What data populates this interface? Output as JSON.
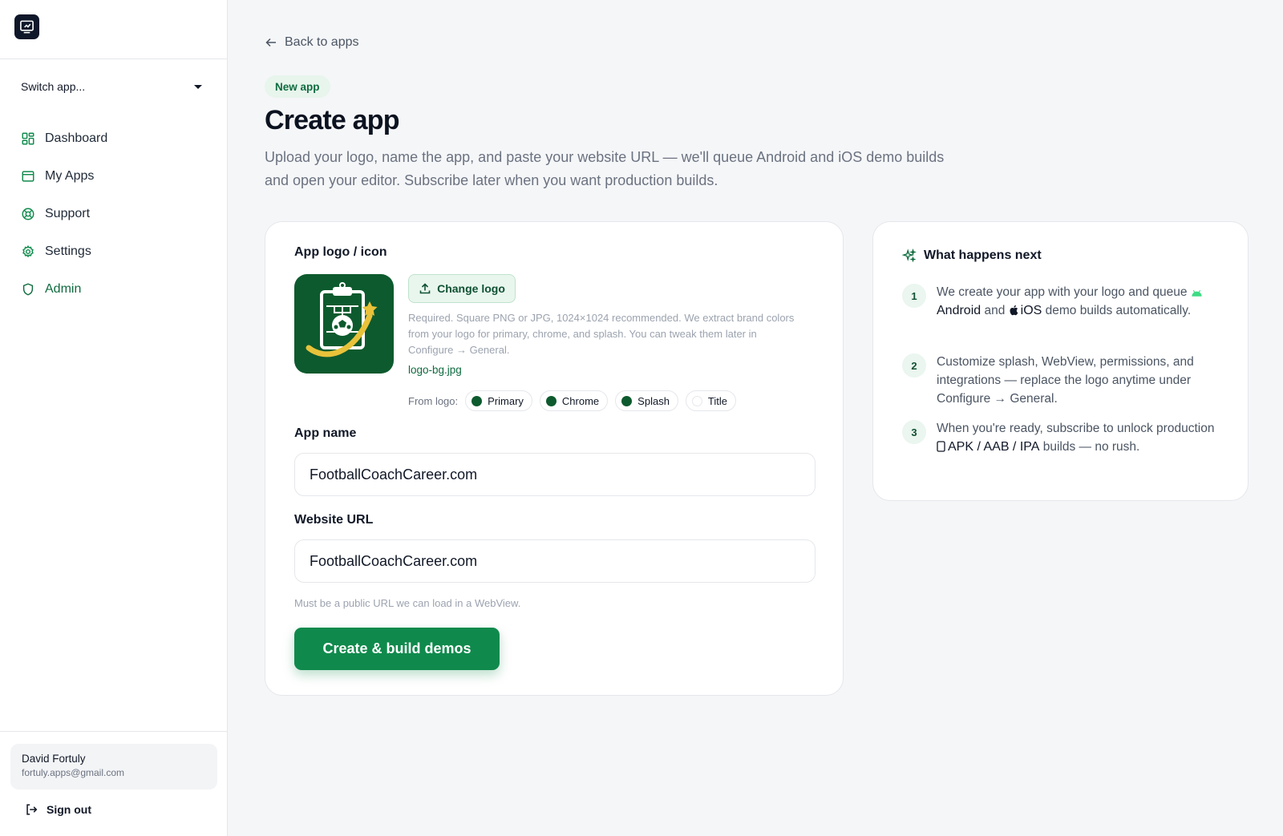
{
  "sidebar": {
    "switch_label": "Switch app...",
    "nav": [
      {
        "label": "Dashboard",
        "icon": "dashboard-icon"
      },
      {
        "label": "My Apps",
        "icon": "apps-icon"
      },
      {
        "label": "Support",
        "icon": "lifebuoy-icon"
      },
      {
        "label": "Settings",
        "icon": "gear-icon"
      },
      {
        "label": "Admin",
        "icon": "shield-icon"
      }
    ],
    "user": {
      "name": "David Fortuly",
      "email": "fortuly.apps@gmail.com"
    },
    "sign_out": "Sign out"
  },
  "header": {
    "back_label": "Back to apps",
    "badge": "New app",
    "title": "Create app",
    "description": "Upload your logo, name the app, and paste your website URL — we'll queue Android and iOS demo builds and open your editor. Subscribe later when you want production builds."
  },
  "form": {
    "logo_label": "App logo / icon",
    "change_logo": "Change logo",
    "logo_help": "Required. Square PNG or JPG, 1024×1024 recommended. We extract brand colors from your logo for primary, chrome, and splash. You can tweak them later in Configure → General.",
    "logo_file": "logo-bg.jpg",
    "from_logo_label": "From logo:",
    "chips": [
      {
        "label": "Primary",
        "color": "#0d5a2e"
      },
      {
        "label": "Chrome",
        "color": "#0d5a2e"
      },
      {
        "label": "Splash",
        "color": "#0d5a2e"
      },
      {
        "label": "Title",
        "color": "#ffffff"
      }
    ],
    "app_name_label": "App name",
    "app_name_value": "FootballCoachCareer.com",
    "url_label": "Website URL",
    "url_value": "FootballCoachCareer.com",
    "url_hint": "Must be a public URL we can load in a WebView.",
    "submit": "Create & build demos"
  },
  "next": {
    "title": "What happens next",
    "steps": [
      {
        "num": "1",
        "a": "We create your app with your logo and queue",
        "android": "Android",
        "and": "and",
        "ios": "iOS",
        "b": "demo builds automatically."
      },
      {
        "num": "2",
        "text": "Customize splash, WebView, permissions, and integrations — replace the logo anytime under Configure → General."
      },
      {
        "num": "3",
        "a": "When you're ready, subscribe to unlock production",
        "formats": "APK / AAB / IPA",
        "b": "builds — no rush."
      }
    ]
  },
  "colors": {
    "accent": "#0f8a4c",
    "accent_dark": "#0f6b3f",
    "logo_bg": "#0d5a2e"
  }
}
